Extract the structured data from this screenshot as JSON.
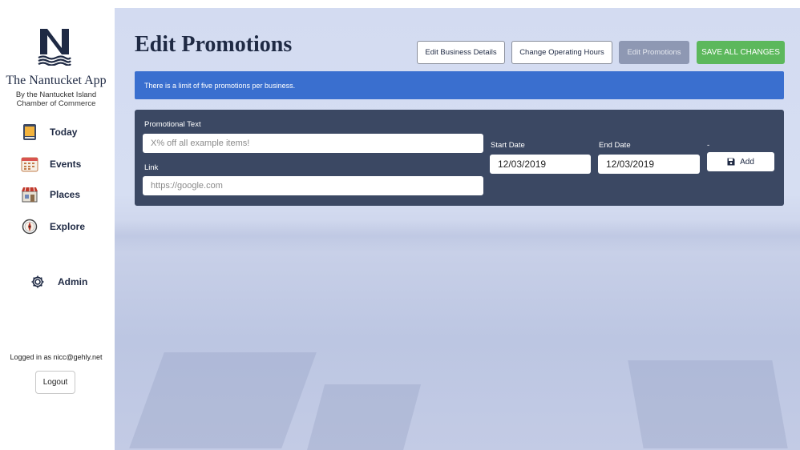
{
  "sidebar": {
    "app_title": "The Nantucket App",
    "app_subtitle_line1": "By the Nantucket Island",
    "app_subtitle_line2": "Chamber of Commerce",
    "nav": [
      {
        "label": "Today",
        "icon": "calendar-today-icon"
      },
      {
        "label": "Events",
        "icon": "calendar-events-icon"
      },
      {
        "label": "Places",
        "icon": "storefront-icon"
      },
      {
        "label": "Explore",
        "icon": "compass-icon"
      }
    ],
    "admin_label": "Admin",
    "logged_in_text": "Logged in as nicc@gehly.net",
    "logout_label": "Logout"
  },
  "header": {
    "title": "Edit Promotions",
    "buttons": {
      "edit_business": "Edit Business Details",
      "change_hours": "Change Operating Hours",
      "edit_promotions": "Edit Promotions",
      "save_all": "SAVE ALL CHANGES"
    }
  },
  "alert": {
    "text": "There is a limit of five promotions per business."
  },
  "form": {
    "promotional_text_label": "Promotional Text",
    "promotional_text_placeholder": "X% off all example items!",
    "link_label": "Link",
    "link_placeholder": "https://google.com",
    "start_date_label": "Start Date",
    "start_date_value": "12/03/2019",
    "end_date_label": "End Date",
    "end_date_value": "12/03/2019",
    "add_label": "Add",
    "dash": "-"
  },
  "colors": {
    "navy": "#1f2a44",
    "alert_blue": "#3a6fcf",
    "panel": "#3b4863",
    "success_green": "#5cb85c",
    "disabled": "#8e98b3"
  }
}
